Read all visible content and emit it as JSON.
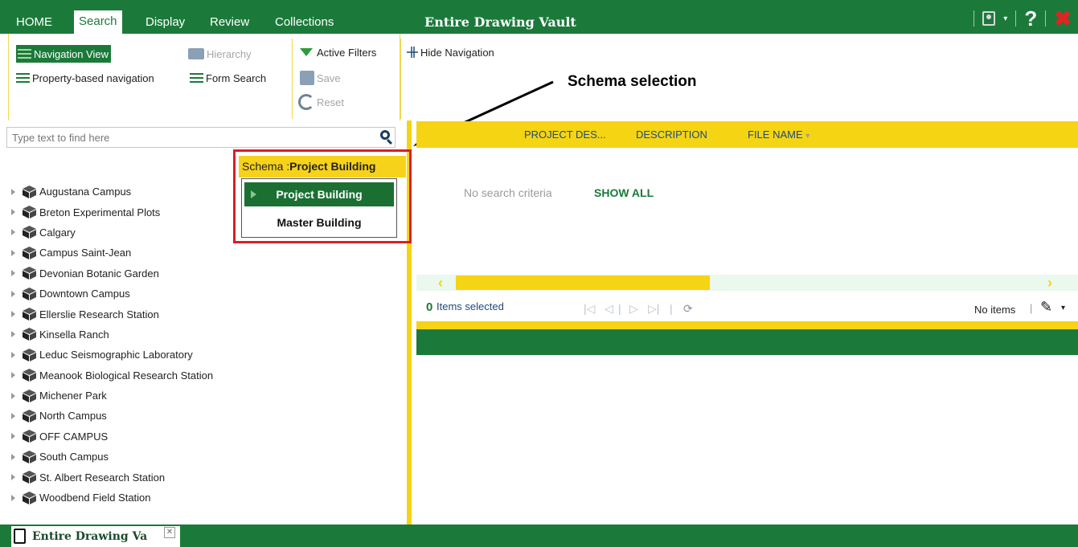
{
  "topbar": {
    "tabs": [
      {
        "label": "HOME"
      },
      {
        "label": "Search"
      },
      {
        "label": "Display"
      },
      {
        "label": "Review"
      },
      {
        "label": "Collections"
      }
    ],
    "active_tab": "Search",
    "title": "Entire Drawing Vault",
    "icons": [
      "user-icon",
      "dropdown-icon",
      "help-icon",
      "close-icon"
    ],
    "colors": {
      "bar": "#1b7a3a",
      "close": "#e52222"
    }
  },
  "ribbon": {
    "navigation_view": "Navigation View",
    "hierarchy": "Hierarchy",
    "property_navigation": "Property-based navigation",
    "form_search": "Form Search",
    "active_filters": "Active Filters",
    "save": "Save",
    "reset": "Reset",
    "hide_navigation": "Hide Navigation"
  },
  "annotation": {
    "label": "Schema selection"
  },
  "search": {
    "placeholder": "Type text to find here"
  },
  "schema": {
    "prefix": "Schema :",
    "current": "Project Building",
    "options": [
      "Project Building",
      "Master Building"
    ],
    "selected_index": 0
  },
  "tree": {
    "items": [
      "Augustana Campus",
      "Breton Experimental Plots",
      "Calgary",
      "Campus Saint-Jean",
      "Devonian Botanic Garden",
      "Downtown Campus",
      "Ellerslie Research Station",
      "Kinsella Ranch",
      "Leduc Seismographic Laboratory",
      "Meanook Biological Research Station",
      "Michener Park",
      "North Campus",
      "OFF CAMPUS",
      "South Campus",
      "St. Albert Research Station",
      "Woodbend Field Station"
    ]
  },
  "results": {
    "columns": [
      "PROJECT DES...",
      "DESCRIPTION",
      "FILE NAME"
    ],
    "no_criteria": "No search criteria",
    "show_all": "SHOW ALL",
    "selected_count": "0",
    "selected_label": "Items selected",
    "no_items": "No items"
  },
  "bottom_tab": {
    "label": "Entire Drawing Va"
  }
}
